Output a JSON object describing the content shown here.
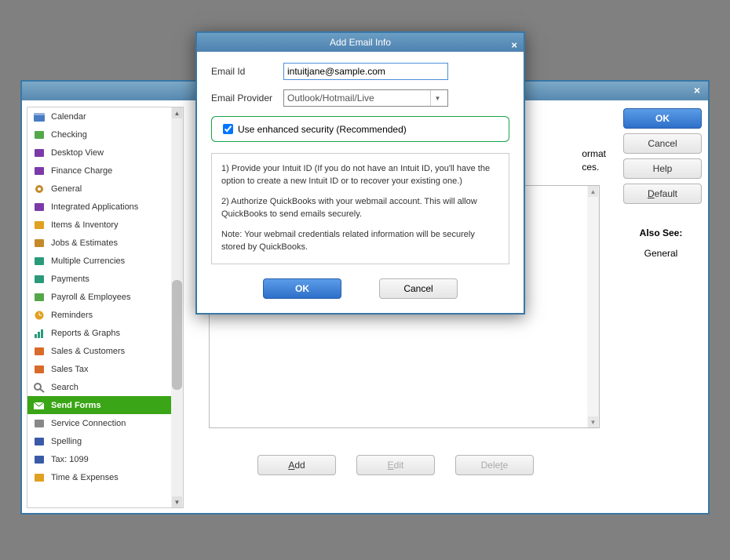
{
  "main": {
    "close_glyph": "×"
  },
  "sidebar": {
    "items": [
      {
        "label": "Calendar",
        "icon": "calendar-icon",
        "fill": "#4a7cc4"
      },
      {
        "label": "Checking",
        "icon": "checking-icon",
        "fill": "#54a84a"
      },
      {
        "label": "Desktop View",
        "icon": "desktop-icon",
        "fill": "#7c3aa8"
      },
      {
        "label": "Finance Charge",
        "icon": "percent-icon",
        "fill": "#7c3aa8"
      },
      {
        "label": "General",
        "icon": "gear-icon",
        "fill": "#c48a2a"
      },
      {
        "label": "Integrated Applications",
        "icon": "apps-icon",
        "fill": "#7c3aa8"
      },
      {
        "label": "Items & Inventory",
        "icon": "inventory-icon",
        "fill": "#e0a020"
      },
      {
        "label": "Jobs & Estimates",
        "icon": "jobs-icon",
        "fill": "#c48a2a"
      },
      {
        "label": "Multiple Currencies",
        "icon": "currency-icon",
        "fill": "#2a9a7a"
      },
      {
        "label": "Payments",
        "icon": "payments-icon",
        "fill": "#2a9a7a"
      },
      {
        "label": "Payroll & Employees",
        "icon": "payroll-icon",
        "fill": "#54a84a"
      },
      {
        "label": "Reminders",
        "icon": "clock-icon",
        "fill": "#e0a020"
      },
      {
        "label": "Reports & Graphs",
        "icon": "chart-icon",
        "fill": "#2a9a7a"
      },
      {
        "label": "Sales & Customers",
        "icon": "sales-icon",
        "fill": "#d86a2a"
      },
      {
        "label": "Sales Tax",
        "icon": "tax-icon",
        "fill": "#d86a2a"
      },
      {
        "label": "Search",
        "icon": "search-icon",
        "fill": "#777"
      },
      {
        "label": "Send Forms",
        "icon": "send-icon",
        "fill": "#fff",
        "selected": true
      },
      {
        "label": "Service Connection",
        "icon": "service-icon",
        "fill": "#888"
      },
      {
        "label": "Spelling",
        "icon": "spell-icon",
        "fill": "#3a5aa8"
      },
      {
        "label": "Tax: 1099",
        "icon": "tax1099-icon",
        "fill": "#3a5aa8"
      },
      {
        "label": "Time & Expenses",
        "icon": "time-icon",
        "fill": "#e0a020"
      }
    ]
  },
  "center": {
    "peek_line1": "ormat",
    "peek_line2": "ces.",
    "add_label": "Add",
    "edit_label": "Edit",
    "delete_label": "Delete"
  },
  "right": {
    "ok_label": "OK",
    "cancel_label": "Cancel",
    "help_label": "Help",
    "default_label": "Default",
    "default_ul": "D",
    "also_see_label": "Also See:",
    "also_see_value": "General"
  },
  "modal": {
    "title": "Add Email Info",
    "close_glyph": "×",
    "email_id_label": "Email Id",
    "email_id_value": "intuitjane@sample.com",
    "provider_label": "Email Provider",
    "provider_value": "Outlook/Hotmail/Live",
    "security_label": "Use enhanced security (Recommended)",
    "security_checked": true,
    "info_p1": "1) Provide your Intuit ID (If you do not have an Intuit ID, you'll have the option to create a new Intuit ID or to recover your existing one.)",
    "info_p2": "2) Authorize QuickBooks with your webmail account. This will allow QuickBooks to send emails securely.",
    "info_note": "Note: Your webmail credentials related  information will be  securely stored by QuickBooks.",
    "ok_label": "OK",
    "cancel_label": "Cancel"
  }
}
